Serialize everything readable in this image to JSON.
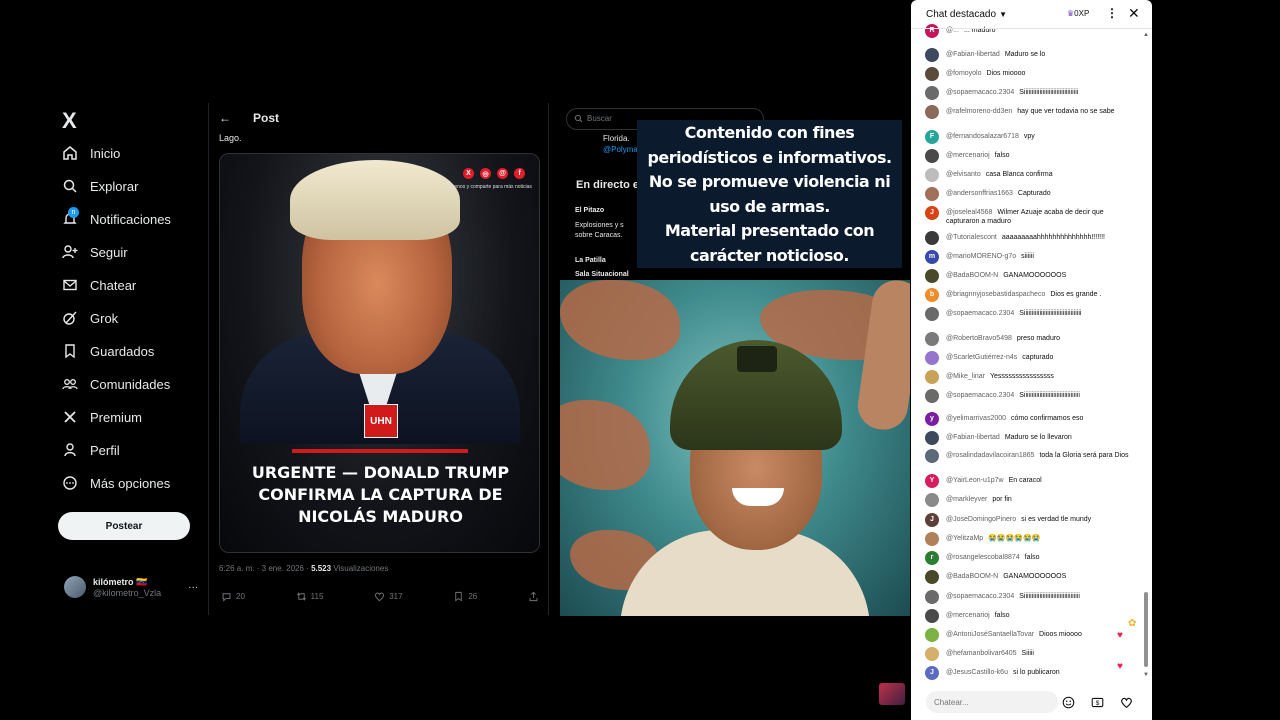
{
  "x_sidebar": {
    "logo": "X",
    "items": [
      {
        "label": "Inicio",
        "icon": "home-icon"
      },
      {
        "label": "Explorar",
        "icon": "search-icon"
      },
      {
        "label": "Notificaciones",
        "icon": "bell-icon",
        "badge": "n"
      },
      {
        "label": "Seguir",
        "icon": "follow-icon"
      },
      {
        "label": "Chatear",
        "icon": "mail-icon"
      },
      {
        "label": "Grok",
        "icon": "grok-icon"
      },
      {
        "label": "Guardados",
        "icon": "bookmark-icon"
      },
      {
        "label": "Comunidades",
        "icon": "communities-icon"
      },
      {
        "label": "Premium",
        "icon": "x-premium-icon"
      },
      {
        "label": "Perfil",
        "icon": "user-icon"
      },
      {
        "label": "Más opciones",
        "icon": "more-icon"
      }
    ],
    "post_button": "Postear",
    "profile": {
      "name": "kilómetro 🇻🇪",
      "handle": "@kilometro_Vzla",
      "more": "···"
    }
  },
  "post": {
    "back": "←",
    "header": "Post",
    "lead_text": "Lago.",
    "image": {
      "caption_social": "Síguenos y comparte para más noticias",
      "badge": "UHN",
      "headline": [
        "URGENTE — DONALD TRUMP",
        "CONFIRMA LA CAPTURA DE",
        "NICOLÁS MADURO"
      ]
    },
    "meta_time": "6:26 a. m. · 3 ene. 2026 · ",
    "meta_views_count": "5.523",
    "meta_views_label": " Visualizaciones",
    "actions": {
      "replies": "20",
      "reposts": "115",
      "likes": "317",
      "bookmarks": "26"
    }
  },
  "x_right": {
    "search_placeholder": "Buscar",
    "snippet_line1": "Florida.",
    "snippet_handle": "@Polyma",
    "live_title": "En directo e",
    "live1_source": "El Pitazo",
    "live1_text": "Explosiones y s",
    "live1_text2": "sobre Caracas.",
    "live2_source": "La Patilla",
    "live2_text": "Sala Situacional"
  },
  "overlay": {
    "disclaimer": [
      "Contenido con fines",
      "periodísticos e informativos.",
      "No se promueve violencia ni",
      "uso de armas.",
      "Material presentado con",
      "carácter noticioso."
    ]
  },
  "chat": {
    "title": "Chat destacado",
    "xp_label": "0XP",
    "input_placeholder": "Chatear...",
    "messages": [
      {
        "author": "@...",
        "text": "... maduro",
        "color": "#c2185b",
        "initial": "R"
      },
      {
        "author": "@Fabian-libertad",
        "text": "Maduro se lo",
        "color": "#3d4a5e",
        "initial": ""
      },
      {
        "author": "@fomoyolo",
        "text": "Dios mioooo",
        "color": "#5a4a3a",
        "initial": ""
      },
      {
        "author": "@sopaemacaco.2304",
        "text": "Siiiiiiiiiiiiiiiiiiiiiiiiiiiiiiiiiii",
        "color": "#6a6a6a",
        "initial": ""
      },
      {
        "author": "@rafelmoreno-dd3en",
        "text": "hay que ver todavia no se sabe",
        "color": "#8a6a5a",
        "initial": ""
      },
      {
        "author": "@fernandosalazar6718",
        "text": "vpy",
        "color": "#26a69a",
        "initial": "F"
      },
      {
        "author": "@mercenarioj",
        "text": "falso",
        "color": "#4a4a4a",
        "initial": ""
      },
      {
        "author": "@elvisanto",
        "text": "casa Blanca confirma",
        "color": "#bdbdbd",
        "initial": ""
      },
      {
        "author": "@andersonffrias1663",
        "text": "Capturado",
        "color": "#a0705a",
        "initial": ""
      },
      {
        "author": "@joseleal4568",
        "text": "Wilmer Azuaje acaba de decir que capturaron a maduro",
        "color": "#d84315",
        "initial": "J"
      },
      {
        "author": "@Tutorialescont",
        "text": "aaaaaaaaahhhhhhhhhhhhhh!!!!!!!",
        "color": "#3a3a3a",
        "initial": ""
      },
      {
        "author": "@marioMORENO-g7o",
        "text": "siiiiii",
        "color": "#3949ab",
        "initial": "m"
      },
      {
        "author": "@BadaBOOM-N",
        "text": "GANAMOOOOOOS",
        "color": "#4a4a2a",
        "initial": ""
      },
      {
        "author": "@briagnnyjosebastidaspacheco",
        "text": "Dios es grande .",
        "color": "#ef8c2a",
        "initial": "b"
      },
      {
        "author": "@sopaemacaco.2304",
        "text": "Siiiiiiiiiiiiiiiiiiiiiiiiiiiiiiiiiiiii",
        "color": "#6a6a6a",
        "initial": ""
      },
      {
        "author": "@RobertoBravo5498",
        "text": "preso maduro",
        "color": "#7a7a7a",
        "initial": ""
      },
      {
        "author": "@ScarletGutiérrez-n4s",
        "text": "capturado",
        "color": "#9575cd",
        "initial": ""
      },
      {
        "author": "@Mike_linar",
        "text": "Yessssssssssssssss",
        "color": "#c9a25a",
        "initial": ""
      },
      {
        "author": "@sopaemacaco.2304",
        "text": "Siiiiiiiiiiiiiiiiiiiiiiiiiiiiiiiiiiii",
        "color": "#6a6a6a",
        "initial": ""
      },
      {
        "author": "@yelimarrivas2000",
        "text": "cómo confirmamos eso",
        "color": "#7b1fa2",
        "initial": "y"
      },
      {
        "author": "@Fabian-libertad",
        "text": "Maduro se lo llevaron",
        "color": "#3d4a5e",
        "initial": ""
      },
      {
        "author": "@rosalindadavilacoiran1865",
        "text": "toda la Gloria será para Dios",
        "color": "#5a6a7a",
        "initial": ""
      },
      {
        "author": "@YairLeon-u1p7w",
        "text": "En caracol",
        "color": "#d81b60",
        "initial": "Y"
      },
      {
        "author": "@markleyver",
        "text": "por fin",
        "color": "#8a8a8a",
        "initial": ""
      },
      {
        "author": "@JoseDomingoPinero",
        "text": "si es verdad tle mundy",
        "color": "#5d4037",
        "initial": "J"
      },
      {
        "author": "@YelitzaMp",
        "text": "😭😭😭😭😭😭",
        "color": "#b0805a",
        "initial": ""
      },
      {
        "author": "@rosangelescobal8874",
        "text": "falso",
        "color": "#2e7d32",
        "initial": "r"
      },
      {
        "author": "@BadaBOOM-N",
        "text": "GANAMOOOOOOS",
        "color": "#4a4a2a",
        "initial": ""
      },
      {
        "author": "@sopaemacaco.2304",
        "text": "Siiiiiiiiiiiiiiiiiiiiiiiiiiiiiiiiiiii",
        "color": "#6a6a6a",
        "initial": ""
      },
      {
        "author": "@mercenarioj",
        "text": "falso",
        "color": "#4a4a4a",
        "initial": ""
      },
      {
        "author": "@AntoniJoséSantaellaTovar",
        "text": "Dioos mioooo",
        "color": "#7cb342",
        "initial": ""
      },
      {
        "author": "@hefamanbolivar6405",
        "text": "Siiiii",
        "color": "#d4b06a",
        "initial": ""
      },
      {
        "author": "@JesusCastillo-k6u",
        "text": "si lo publicaron",
        "color": "#5c6bc0",
        "initial": "J"
      }
    ]
  },
  "colors": {
    "x_blue": "#1d9bf0",
    "headline_red": "#d11a1a",
    "chat_bg": "#ffffff",
    "heart": "#e2264d"
  }
}
